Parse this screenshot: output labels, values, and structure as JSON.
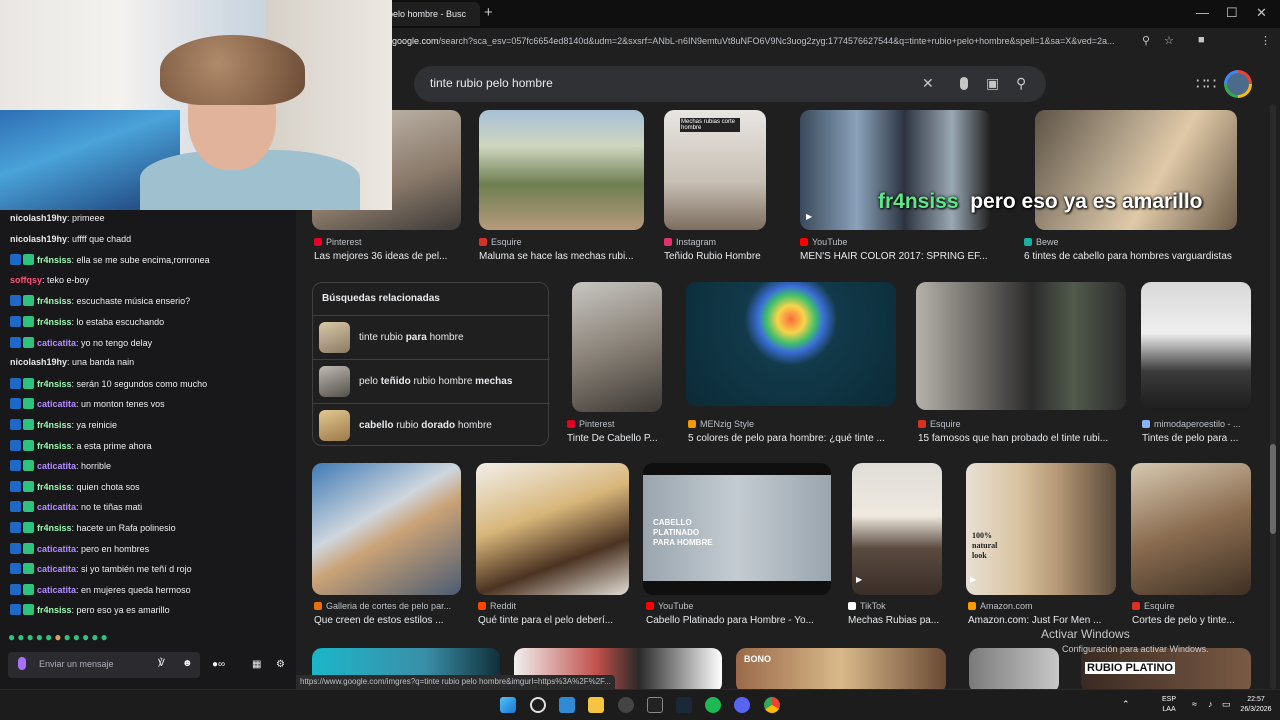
{
  "browser": {
    "tab_title": "pelo hombre - Busc",
    "new_tab": "+",
    "url_prefix": "google.com",
    "url_rest": "/search?sca_esv=057fc6654ed8140d&udm=2&sxsrf=ANbL-n6IN9emtuVt8uNFO6V9Nc3uog2zyg:1774576627544&q=tinte+rubio+pelo+hombre&spell=1&sa=X&ved=2a...",
    "status_url": "https://www.google.com/imgres?q=tinte rubio pelo hombre&imgurl=https%3A%2F%2F..."
  },
  "search": {
    "query": "tinte rubio pelo hombre"
  },
  "results_row1": [
    {
      "source": "Pinterest",
      "title": "Las mejores 36 ideas de pel...",
      "color": "#e60023"
    },
    {
      "source": "Esquire",
      "title": "Maluma se hace las mechas rubi...",
      "color": "#d93025"
    },
    {
      "source": "Instagram",
      "title": "Teñido Rubio Hombre",
      "color": "#e1306c",
      "overlay": "Mechas rubias corte hombre"
    },
    {
      "source": "YouTube",
      "title": "MEN'S HAIR COLOR 2017: SPRING EF...",
      "color": "#ff0000"
    },
    {
      "source": "Bewe",
      "title": "6 tintes de cabello para hombres varguardistas",
      "color": "#18b0a0"
    }
  ],
  "related": {
    "title": "Búsquedas relacionadas",
    "items": [
      {
        "pre": "tinte rubio ",
        "bold": "para",
        "post": " hombre"
      },
      {
        "pre": "pelo ",
        "bold": "teñido",
        "post": " rubio hombre ",
        "bold2": "mechas"
      },
      {
        "pre": "",
        "bold": "cabello",
        "post": " rubio ",
        "bold2": "dorado",
        "post2": " hombre"
      }
    ]
  },
  "results_row2": [
    {
      "source": "Pinterest",
      "title": "Tinte De Cabello P...",
      "color": "#e60023"
    },
    {
      "source": "MENzig Style",
      "title": "5 colores de pelo para hombre: ¿qué tinte ...",
      "color": "#f29900"
    },
    {
      "source": "Esquire",
      "title": "15 famosos que han probado el tinte rubi...",
      "color": "#d93025"
    },
    {
      "source": "mimodaperoestilo - ...",
      "title": "Tintes de pelo para ...",
      "color": "#8ab4f8"
    }
  ],
  "results_row3": [
    {
      "source": "Galleria de cortes de pelo par...",
      "title": "Que creen de estos estilos ...",
      "color": "#e8710a"
    },
    {
      "source": "Reddit",
      "title": "Qué tinte para el pelo deberí...",
      "color": "#ff4500"
    },
    {
      "source": "YouTube",
      "title": "Cabello Platinado para Hombre - Yo...",
      "color": "#ff0000",
      "overlay": "CABELLO PLATINADO PARA HOMBRE"
    },
    {
      "source": "TikTok",
      "title": "Mechas Rubias pa...",
      "color": "#ffffff"
    },
    {
      "source": "Amazon.com",
      "title": "Amazon.com: Just For Men ...",
      "color": "#ff9900",
      "overlay": "100% natural look"
    },
    {
      "source": "Esquire",
      "title": "Cortes de pelo y tinte...",
      "color": "#d93025"
    }
  ],
  "row4_overlays": [
    "BONO",
    "RUBIO PLATINO"
  ],
  "stream_overlay": {
    "user": "fr4nsiss",
    "text": "pero eso ya es amarillo"
  },
  "windows_watermark": {
    "line1": "Activar Windows",
    "line2": "Configuración para activar Windows."
  },
  "chat": {
    "messages": [
      {
        "user": "nicolash19hy",
        "text": "primeee",
        "color": "#e8e8e8",
        "badge": false
      },
      {
        "user": "nicolash19hy",
        "text": "uffff que chadd",
        "color": "#e8e8e8",
        "badge": false
      },
      {
        "user": "fr4nsiss",
        "text": "ella se me sube encima,ronronea",
        "color": "#9bf7b0",
        "badge": true
      },
      {
        "user": "soffqsy",
        "text": "teko e-boy",
        "color": "#ff4f7b",
        "badge": false
      },
      {
        "user": "fr4nsiss",
        "text": "escuchaste música enserio?",
        "color": "#9bf7b0",
        "badge": true
      },
      {
        "user": "fr4nsiss",
        "text": "lo estaba escuchando",
        "color": "#9bf7b0",
        "badge": true
      },
      {
        "user": "caticatita",
        "text": "yo no tengo delay",
        "color": "#b48cff",
        "badge": true
      },
      {
        "user": "nicolash19hy",
        "text": "una banda nain",
        "color": "#e8e8e8",
        "badge": false
      },
      {
        "user": "fr4nsiss",
        "text": "serán 10 segundos como mucho",
        "color": "#9bf7b0",
        "badge": true
      },
      {
        "user": "caticatita",
        "text": "un monton tenes vos",
        "color": "#b48cff",
        "badge": true
      },
      {
        "user": "fr4nsiss",
        "text": "ya reinicie",
        "color": "#9bf7b0",
        "badge": true
      },
      {
        "user": "fr4nsiss",
        "text": "a esta prime ahora",
        "color": "#9bf7b0",
        "badge": true
      },
      {
        "user": "caticatita",
        "text": "horrible",
        "color": "#b48cff",
        "badge": true
      },
      {
        "user": "fr4nsiss",
        "text": "quien chota sos",
        "color": "#9bf7b0",
        "badge": true
      },
      {
        "user": "caticatita",
        "text": "no te tiñas mati",
        "color": "#b48cff",
        "badge": true
      },
      {
        "user": "fr4nsiss",
        "text": "hacete un Rafa polinesio",
        "color": "#9bf7b0",
        "badge": true
      },
      {
        "user": "caticatita",
        "text": "pero en hombres",
        "color": "#b48cff",
        "badge": true
      },
      {
        "user": "caticatita",
        "text": "si yo también me teñí d rojo",
        "color": "#b48cff",
        "badge": true
      },
      {
        "user": "caticatita",
        "text": "en mujeres queda hermoso",
        "color": "#b48cff",
        "badge": true
      },
      {
        "user": "fr4nsiss",
        "text": "pero eso ya es amarillo",
        "color": "#9bf7b0",
        "badge": true
      }
    ],
    "input_placeholder": "Enviar un mensaje"
  },
  "taskbar": {
    "lang1": "ESP",
    "lang2": "LAA",
    "time": "22:57",
    "date": "26/3/2026"
  }
}
